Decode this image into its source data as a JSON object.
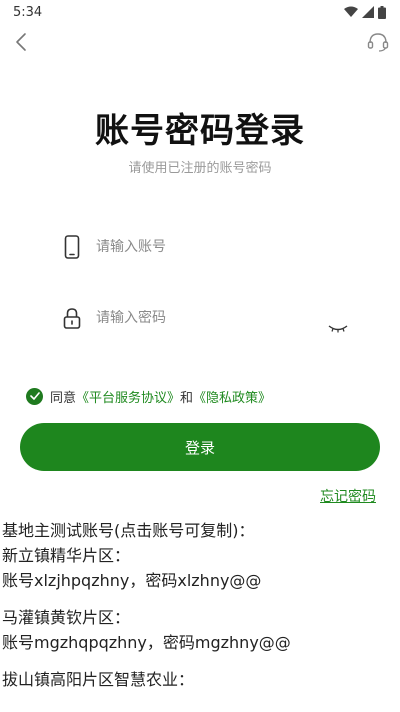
{
  "status": {
    "time": "5:34"
  },
  "header": {
    "title": "账号密码登录",
    "subtitle": "请使用已注册的账号密码"
  },
  "form": {
    "account_placeholder": "请输入账号",
    "password_placeholder": "请输入密码"
  },
  "agreement": {
    "prefix": "同意",
    "platform_link": "《平台服务协议》",
    "and": "和",
    "privacy_link": "《隐私政策》"
  },
  "login_button": "登录",
  "forgot_link": "忘记密码",
  "info": {
    "heading": "基地主测试账号(点击账号可复制)：",
    "sections": [
      {
        "name": "新立镇精华片区：",
        "account": "账号xlzjhpqzhny，密码xlzhny@@"
      },
      {
        "name": "马灌镇黄钦片区：",
        "account": "账号mgzhqpqzhny，密码mgzhny@@"
      },
      {
        "name": "拔山镇高阳片区智慧农业："
      }
    ]
  },
  "colors": {
    "primary": "#1e861e",
    "link": "#1f8a1f"
  }
}
